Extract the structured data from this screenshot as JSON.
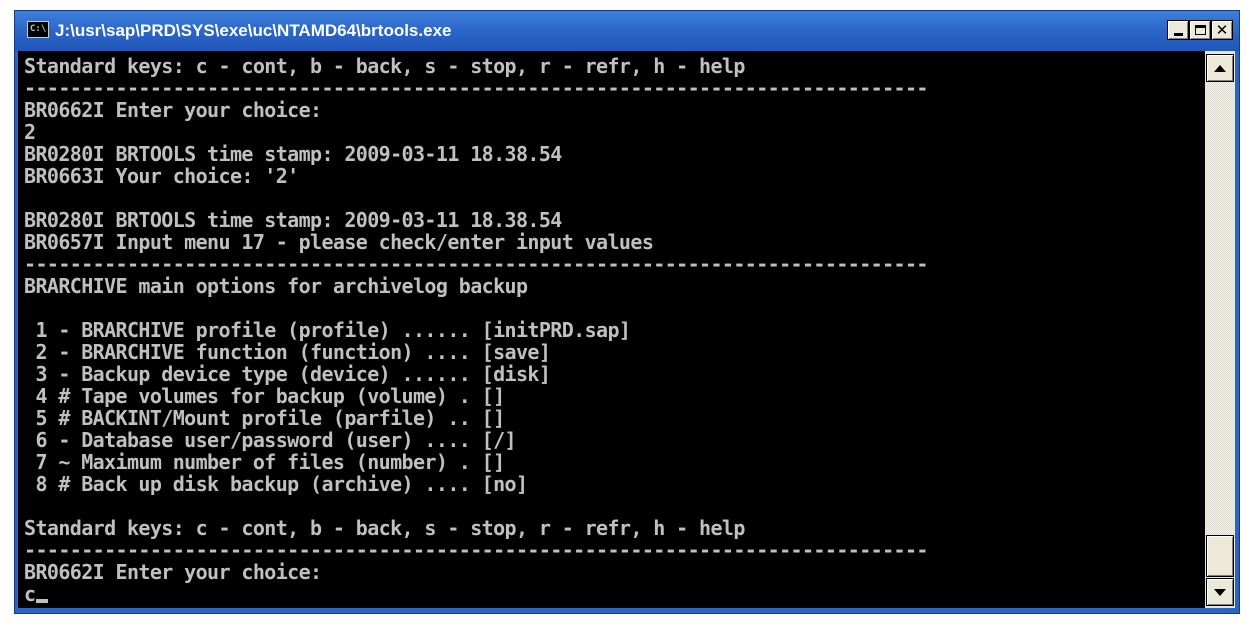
{
  "window": {
    "title": "J:\\usr\\sap\\PRD\\SYS\\exe\\uc\\NTAMD64\\brtools.exe",
    "icon_label": "C:\\",
    "icon": "console-window-icon",
    "controls": [
      "minimize-icon",
      "maximize-icon",
      "close-icon"
    ],
    "close_glyph": "✕"
  },
  "console": {
    "colors": {
      "background": "#000000",
      "text": "#c0c0c0"
    },
    "lines": [
      "Standard keys: c - cont, b - back, s - stop, r - refr, h - help",
      "-------------------------------------------------------------------------------",
      "BR0662I Enter your choice:",
      "2",
      "BR0280I BRTOOLS time stamp: 2009-03-11 18.38.54",
      "BR0663I Your choice: '2'",
      "",
      "BR0280I BRTOOLS time stamp: 2009-03-11 18.38.54",
      "BR0657I Input menu 17 - please check/enter input values",
      "-------------------------------------------------------------------------------",
      "BRARCHIVE main options for archivelog backup",
      "",
      " 1 - BRARCHIVE profile (profile) ...... [initPRD.sap]",
      " 2 - BRARCHIVE function (function) .... [save]",
      " 3 - Backup device type (device) ...... [disk]",
      " 4 # Tape volumes for backup (volume) . []",
      " 5 # BACKINT/Mount profile (parfile) .. []",
      " 6 - Database user/password (user) .... [/]",
      " 7 ~ Maximum number of files (number) . []",
      " 8 # Back up disk backup (archive) .... [no]",
      "",
      "Standard keys: c - cont, b - back, s - stop, r - refr, h - help",
      "-------------------------------------------------------------------------------",
      "BR0662I Enter your choice:",
      "c"
    ]
  },
  "scrollbar": {
    "up_icon": "scroll-up-arrow-icon",
    "down_icon": "scroll-down-arrow-icon",
    "position_fraction": 1.0
  }
}
